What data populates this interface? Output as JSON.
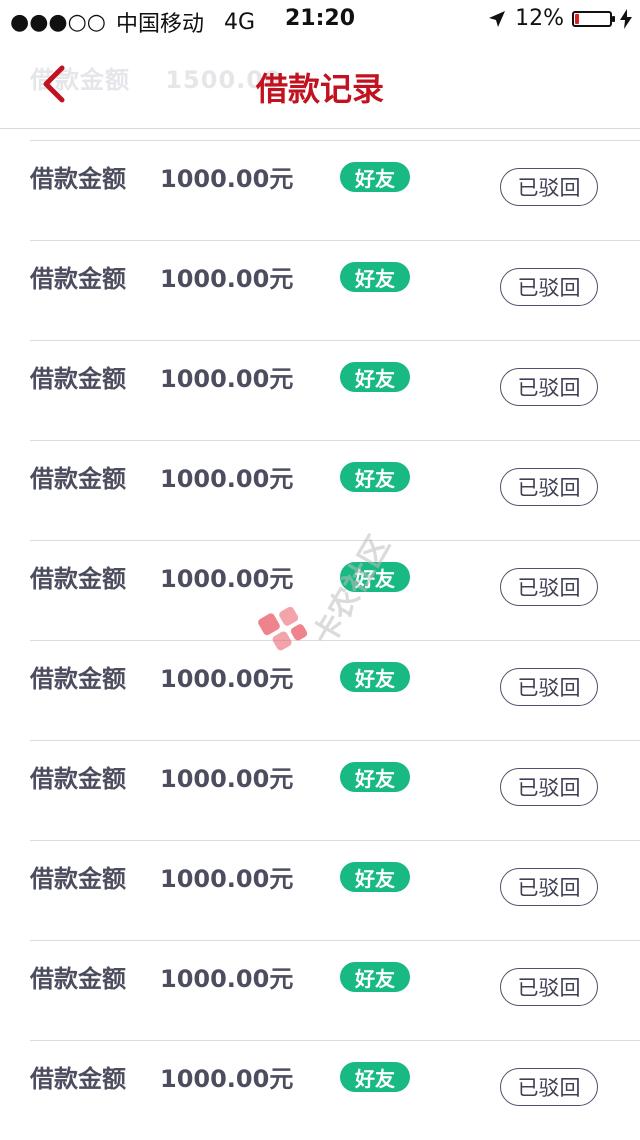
{
  "status_bar": {
    "signal": "●●●○○",
    "carrier": "中国移动",
    "network": "4G",
    "time": "21:20",
    "battery_percent": "12%",
    "battery_level": 0.12
  },
  "nav": {
    "title": "借款记录",
    "ghost_label": "借款金额",
    "ghost_amount": "1500.00"
  },
  "list": [
    {
      "label": "借款金额",
      "amount": "1000.00元",
      "tag": "好友",
      "status": "已驳回"
    },
    {
      "label": "借款金额",
      "amount": "1000.00元",
      "tag": "好友",
      "status": "已驳回"
    },
    {
      "label": "借款金额",
      "amount": "1000.00元",
      "tag": "好友",
      "status": "已驳回"
    },
    {
      "label": "借款金额",
      "amount": "1000.00元",
      "tag": "好友",
      "status": "已驳回"
    },
    {
      "label": "借款金额",
      "amount": "1000.00元",
      "tag": "好友",
      "status": "已驳回"
    },
    {
      "label": "借款金额",
      "amount": "1000.00元",
      "tag": "好友",
      "status": "已驳回"
    },
    {
      "label": "借款金额",
      "amount": "1000.00元",
      "tag": "好友",
      "status": "已驳回"
    },
    {
      "label": "借款金额",
      "amount": "1000.00元",
      "tag": "好友",
      "status": "已驳回"
    },
    {
      "label": "借款金额",
      "amount": "1000.00元",
      "tag": "好友",
      "status": "已驳回"
    },
    {
      "label": "借款金额",
      "amount": "1000.00元",
      "tag": "好友",
      "status": "已驳回"
    }
  ],
  "watermark": {
    "text": "卡农社区"
  },
  "colors": {
    "accent": "#c0121f",
    "tag_bg": "#18b983",
    "text": "#4d4d60"
  }
}
